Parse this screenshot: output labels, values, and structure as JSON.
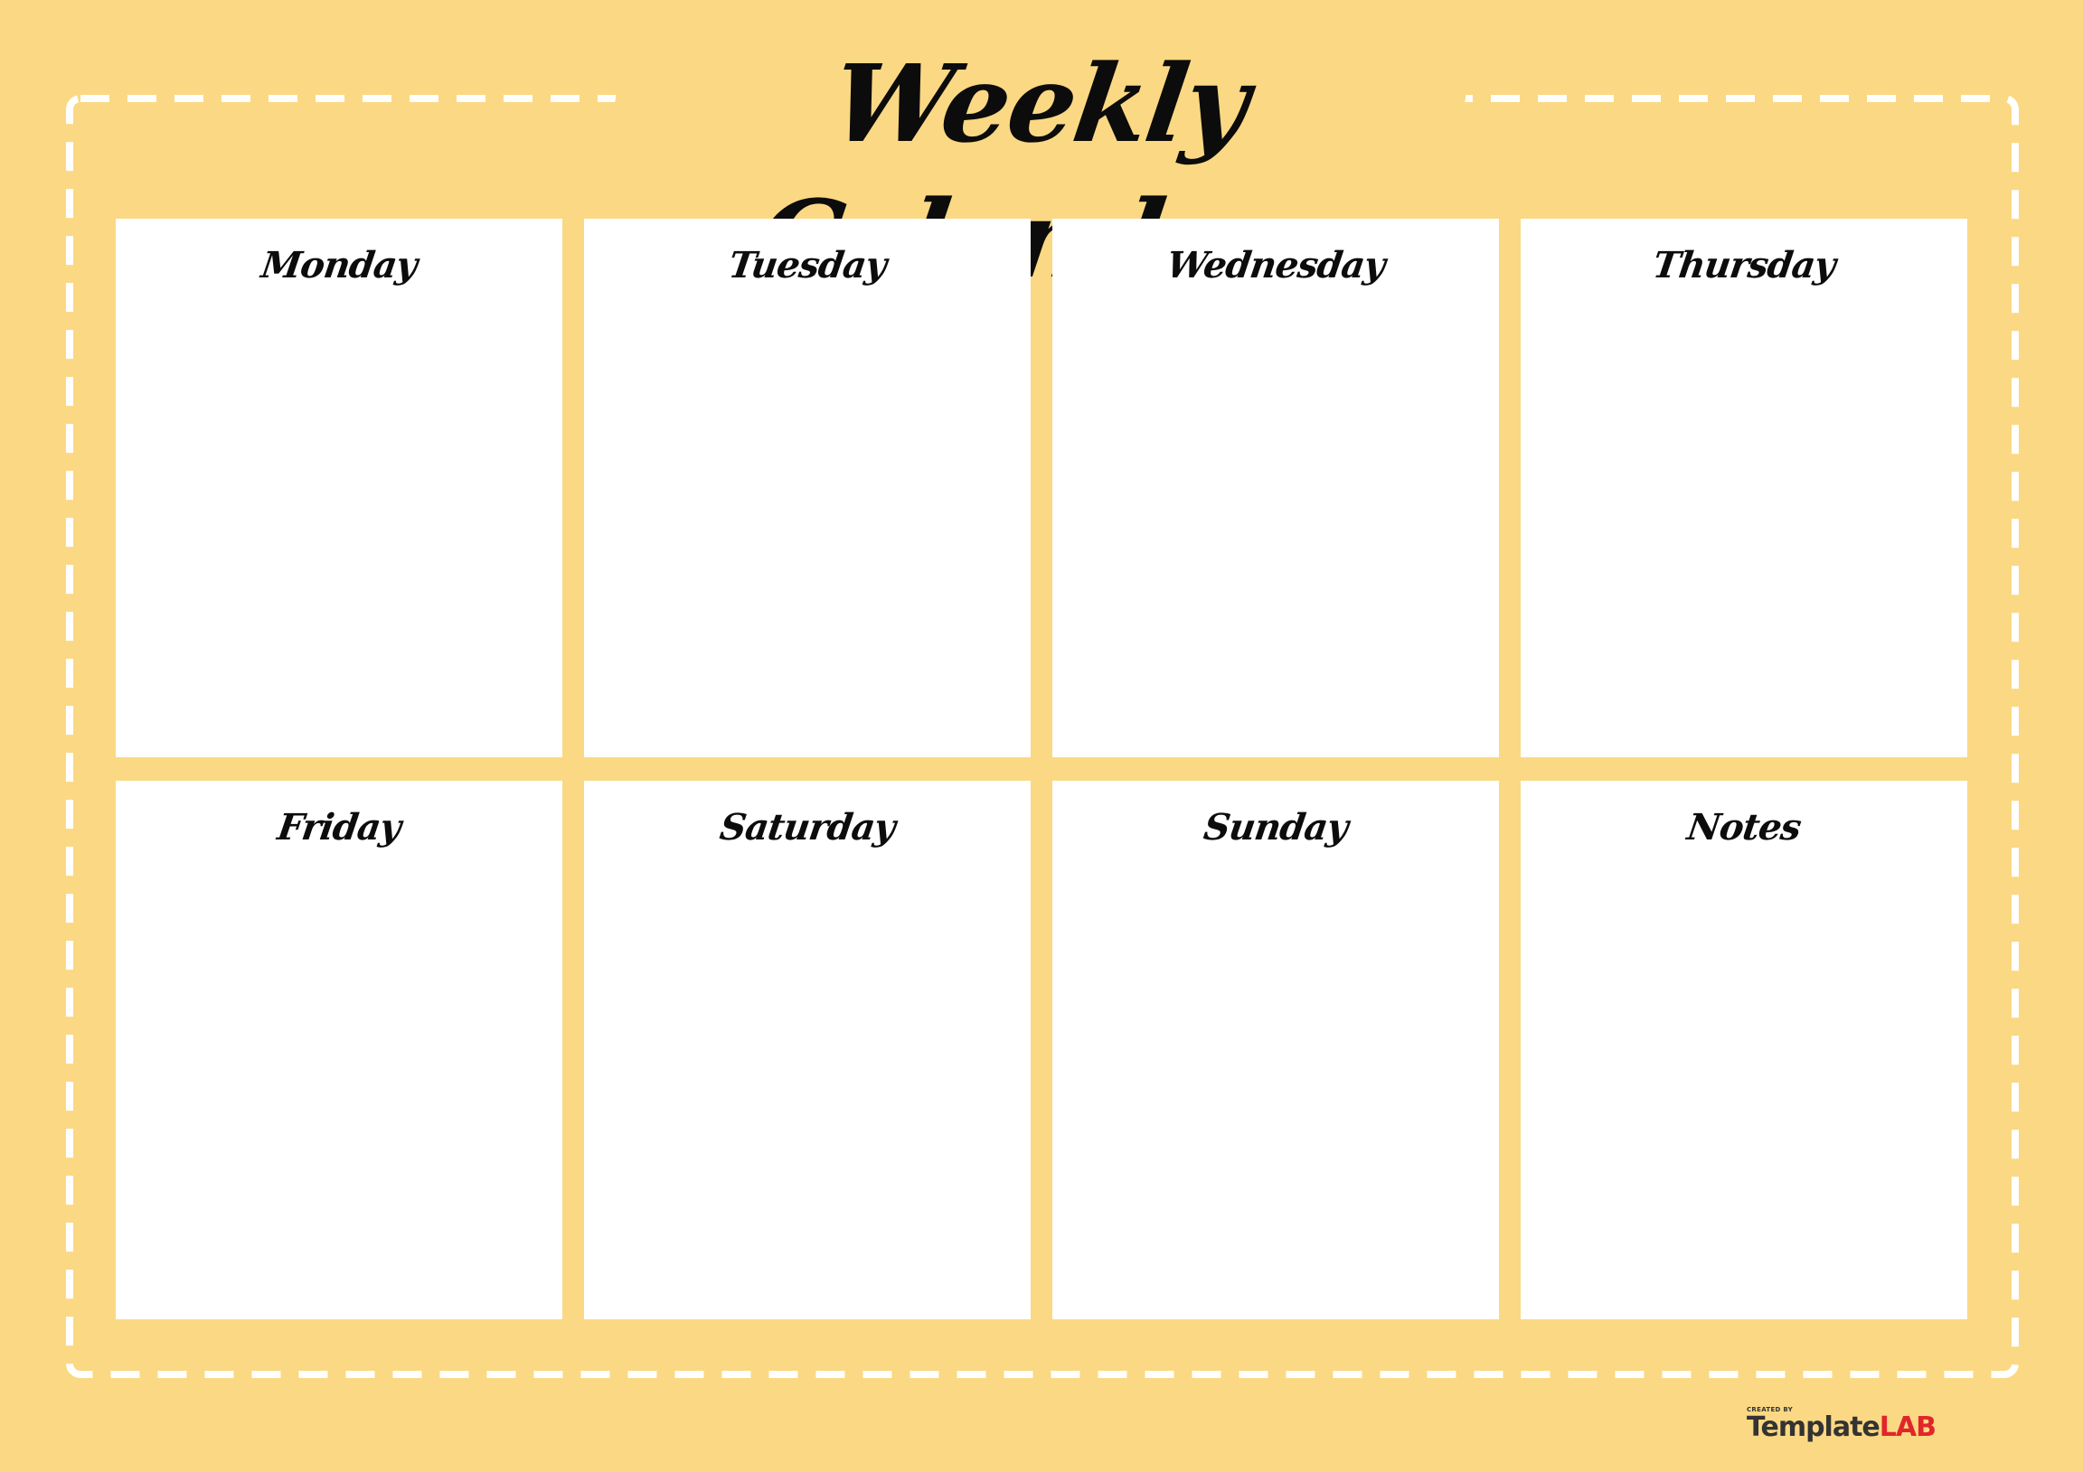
{
  "title": "Weekly Calendar",
  "days": [
    {
      "label": "Monday"
    },
    {
      "label": "Tuesday"
    },
    {
      "label": "Wednesday"
    },
    {
      "label": "Thursday"
    },
    {
      "label": "Friday"
    },
    {
      "label": "Saturday"
    },
    {
      "label": "Sunday"
    },
    {
      "label": "Notes"
    }
  ],
  "logo": {
    "created_by": "CREATED BY",
    "brand_part1": "Template",
    "brand_part2": "LAB"
  },
  "colors": {
    "background": "#FBD883",
    "panel": "#FFFFFF",
    "dash": "#FFFFFF",
    "text": "#0C0C0C",
    "brand_red": "#E0262B",
    "brand_dark": "#333333"
  }
}
